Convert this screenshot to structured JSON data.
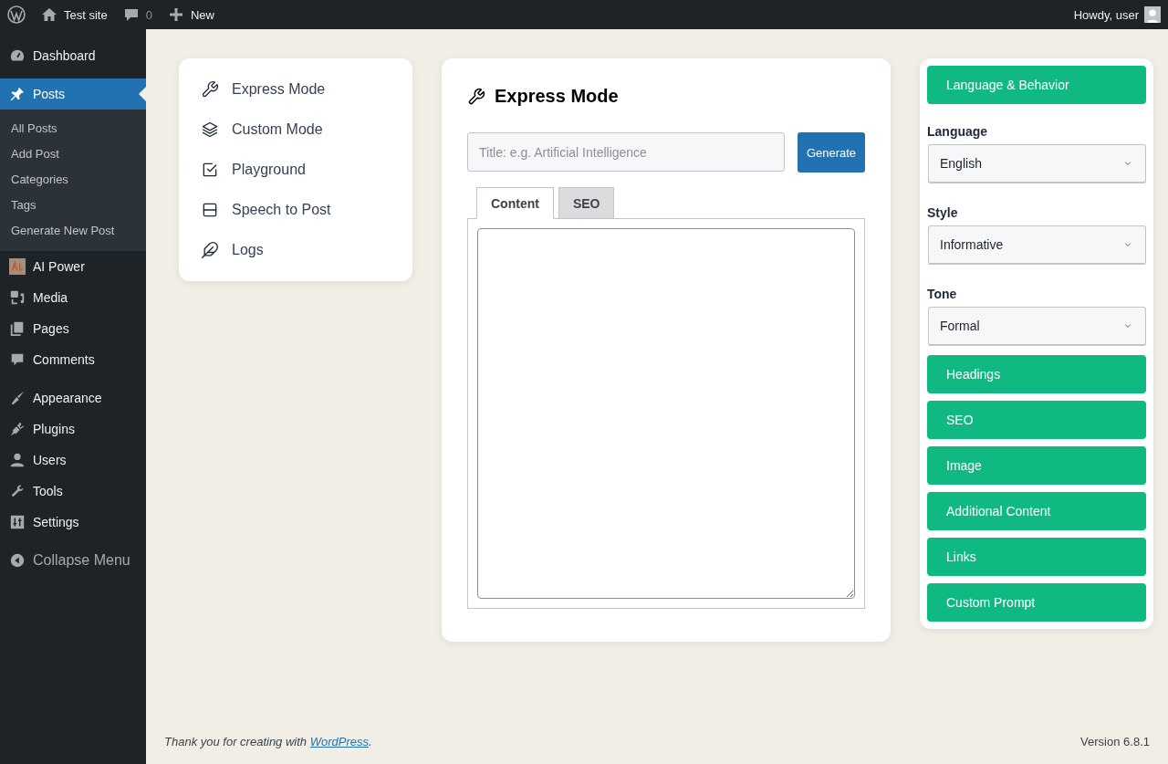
{
  "admin_bar": {
    "site_title": "Test site",
    "comments_count": "0",
    "new_label": "New",
    "greeting": "Howdy, user"
  },
  "sidebar": {
    "groups": [
      {
        "items": [
          {
            "label": "Dashboard",
            "selected": false
          }
        ]
      },
      {
        "items": [
          {
            "label": "Posts",
            "selected": true,
            "children": [
              {
                "label": "All Posts"
              },
              {
                "label": "Add Post"
              },
              {
                "label": "Categories"
              },
              {
                "label": "Tags"
              },
              {
                "label": "Generate New Post"
              }
            ]
          },
          {
            "label": "AI Power",
            "selected": false
          },
          {
            "label": "Media",
            "selected": false
          },
          {
            "label": "Pages",
            "selected": false
          },
          {
            "label": "Comments",
            "selected": false
          }
        ]
      },
      {
        "items": [
          {
            "label": "Appearance",
            "selected": false
          },
          {
            "label": "Plugins",
            "selected": false
          },
          {
            "label": "Users",
            "selected": false
          },
          {
            "label": "Tools",
            "selected": false
          },
          {
            "label": "Settings",
            "selected": false
          }
        ]
      }
    ],
    "collapse_label": "Collapse Menu"
  },
  "modes": [
    {
      "label": "Express Mode"
    },
    {
      "label": "Custom Mode"
    },
    {
      "label": "Playground"
    },
    {
      "label": "Speech to Post"
    },
    {
      "label": "Logs"
    }
  ],
  "editor": {
    "title": "Express Mode",
    "title_field": {
      "placeholder": "Title: e.g. Artificial Intelligence"
    },
    "generate_button": "Generate",
    "tabs": [
      {
        "label": "Content",
        "selected": true
      },
      {
        "label": "SEO",
        "selected": false
      }
    ]
  },
  "settings_panel": [
    {
      "kind": "section",
      "label": "Language & Behavior"
    },
    {
      "kind": "select",
      "label": "Language",
      "value": "English"
    },
    {
      "kind": "select",
      "label": "Style",
      "value": "Informative"
    },
    {
      "kind": "select",
      "label": "Tone",
      "value": "Formal"
    },
    {
      "kind": "section",
      "label": "Headings"
    },
    {
      "kind": "section",
      "label": "SEO"
    },
    {
      "kind": "section",
      "label": "Image"
    },
    {
      "kind": "section",
      "label": "Additional Content"
    },
    {
      "kind": "section",
      "label": "Links"
    },
    {
      "kind": "section",
      "label": "Custom Prompt"
    }
  ],
  "footer": {
    "thanks_before": "Thank you for creating with ",
    "link": "WordPress",
    "thanks_after": ".",
    "version": "Version 6.8.1"
  }
}
